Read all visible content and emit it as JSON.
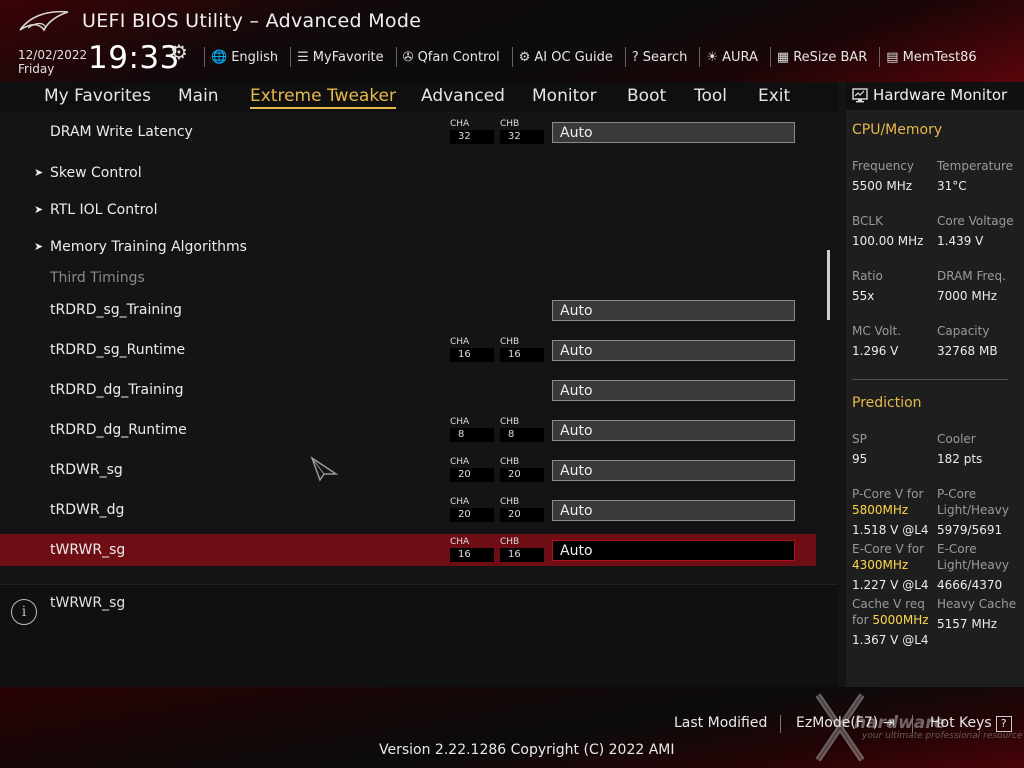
{
  "header": {
    "title": "UEFI BIOS Utility – Advanced Mode",
    "date": "12/02/2022",
    "day": "Friday",
    "time": "19:33"
  },
  "toolbar": [
    {
      "icon": "globe-icon",
      "glyph": "🌐",
      "label": "English"
    },
    {
      "icon": "favorite-list-icon",
      "glyph": "☰",
      "label": "MyFavorite"
    },
    {
      "icon": "fan-icon",
      "glyph": "✇",
      "label": "Qfan Control"
    },
    {
      "icon": "ai-chip-icon",
      "glyph": "⚙",
      "label": "AI OC Guide"
    },
    {
      "icon": "search-help-icon",
      "glyph": "?",
      "label": "Search"
    },
    {
      "icon": "aura-light-icon",
      "glyph": "☀",
      "label": "AURA"
    },
    {
      "icon": "resize-bar-icon",
      "glyph": "▦",
      "label": "ReSize BAR"
    },
    {
      "icon": "memtest-icon",
      "glyph": "▤",
      "label": "MemTest86"
    }
  ],
  "tabs": [
    "My Favorites",
    "Main",
    "Extreme Tweaker",
    "Advanced",
    "Monitor",
    "Boot",
    "Tool",
    "Exit"
  ],
  "active_tab": "Extreme Tweaker",
  "settings": [
    {
      "label": "DRAM Write Latency",
      "cha": "32",
      "chb": "32",
      "value": "Auto"
    },
    {
      "label": "Skew Control",
      "submenu": true
    },
    {
      "label": "RTL IOL Control",
      "submenu": true
    },
    {
      "label": "Memory Training Algorithms",
      "submenu": true
    },
    {
      "label": "Third Timings",
      "header": true
    },
    {
      "label": "tRDRD_sg_Training",
      "value": "Auto"
    },
    {
      "label": "tRDRD_sg_Runtime",
      "cha": "16",
      "chb": "16",
      "value": "Auto"
    },
    {
      "label": "tRDRD_dg_Training",
      "value": "Auto"
    },
    {
      "label": "tRDRD_dg_Runtime",
      "cha": "8",
      "chb": "8",
      "value": "Auto"
    },
    {
      "label": "tRDWR_sg",
      "cha": "20",
      "chb": "20",
      "value": "Auto"
    },
    {
      "label": "tRDWR_dg",
      "cha": "20",
      "chb": "20",
      "value": "Auto"
    },
    {
      "label": "tWRWR_sg",
      "cha": "16",
      "chb": "16",
      "value": "Auto",
      "selected": true
    }
  ],
  "channel_labels": {
    "a": "CHA",
    "b": "CHB"
  },
  "help_text": "tWRWR_sg",
  "hardware_monitor": {
    "title": "Hardware Monitor",
    "cpu_memory_title": "CPU/Memory",
    "cpu_memory": [
      {
        "k": "Frequency",
        "v": "5500 MHz"
      },
      {
        "k": "Temperature",
        "v": "31°C"
      },
      {
        "k": "BCLK",
        "v": "100.00 MHz"
      },
      {
        "k": "Core Voltage",
        "v": "1.439 V"
      },
      {
        "k": "Ratio",
        "v": "55x"
      },
      {
        "k": "DRAM Freq.",
        "v": "7000 MHz"
      },
      {
        "k": "MC Volt.",
        "v": "1.296 V"
      },
      {
        "k": "Capacity",
        "v": "32768 MB"
      }
    ],
    "prediction_title": "Prediction",
    "prediction": {
      "sp_k": "SP",
      "sp_v": "95",
      "cooler_k": "Cooler",
      "cooler_v": "182 pts",
      "pcore_v_k": "P-Core V for",
      "pcore_v_freq": "5800MHz",
      "pcore_v_v": "1.518 V @L4",
      "pcore_lh_k1": "P-Core",
      "pcore_lh_k2": "Light/Heavy",
      "pcore_lh_v": "5979/5691",
      "ecore_v_k": "E-Core V for",
      "ecore_v_freq": "4300MHz",
      "ecore_v_v": "1.227 V @L4",
      "ecore_lh_k1": "E-Core",
      "ecore_lh_k2": "Light/Heavy",
      "ecore_lh_v": "4666/4370",
      "cache_k1": "Cache V req",
      "cache_k2": "for",
      "cache_freq": "5000MHz",
      "cache_v": "1.367 V @L4",
      "heavy_cache_k": "Heavy Cache",
      "heavy_cache_v": "5157 MHz"
    }
  },
  "footer": {
    "last_modified": "Last Modified",
    "ezmode": "EzMode(F7)",
    "hotkeys": "Hot Keys",
    "hotkeys_key": "?",
    "version": "Version 2.22.1286 Copyright (C) 2022 AMI",
    "watermark": "hardware",
    "watermark_sub": "your ultimate professional resource"
  }
}
